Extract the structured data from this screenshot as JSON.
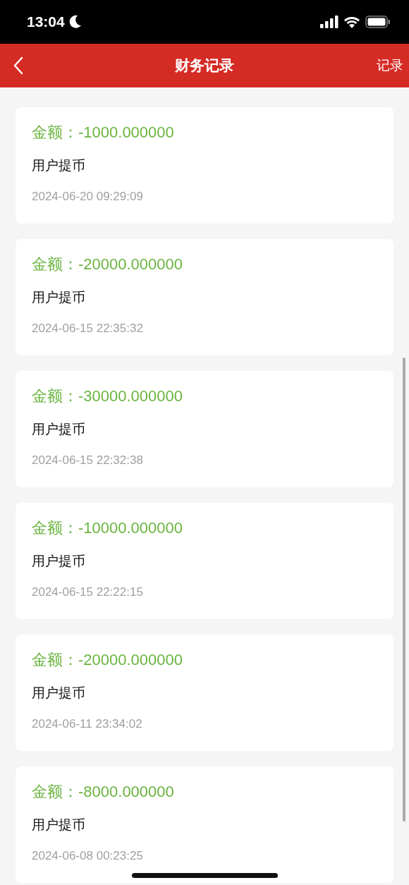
{
  "status_bar": {
    "time": "13:04"
  },
  "header": {
    "title": "财务记录",
    "action": "记录"
  },
  "records": [
    {
      "amount": "金额：-1000.000000",
      "description": "用户提币",
      "time": "2024-06-20 09:29:09"
    },
    {
      "amount": "金额：-20000.000000",
      "description": "用户提币",
      "time": "2024-06-15 22:35:32"
    },
    {
      "amount": "金额：-30000.000000",
      "description": "用户提币",
      "time": "2024-06-15 22:32:38"
    },
    {
      "amount": "金额：-10000.000000",
      "description": "用户提币",
      "time": "2024-06-15 22:22:15"
    },
    {
      "amount": "金额：-20000.000000",
      "description": "用户提币",
      "time": "2024-06-11 23:34:02"
    },
    {
      "amount": "金额：-8000.000000",
      "description": "用户提币",
      "time": "2024-06-08 00:23:25"
    }
  ]
}
